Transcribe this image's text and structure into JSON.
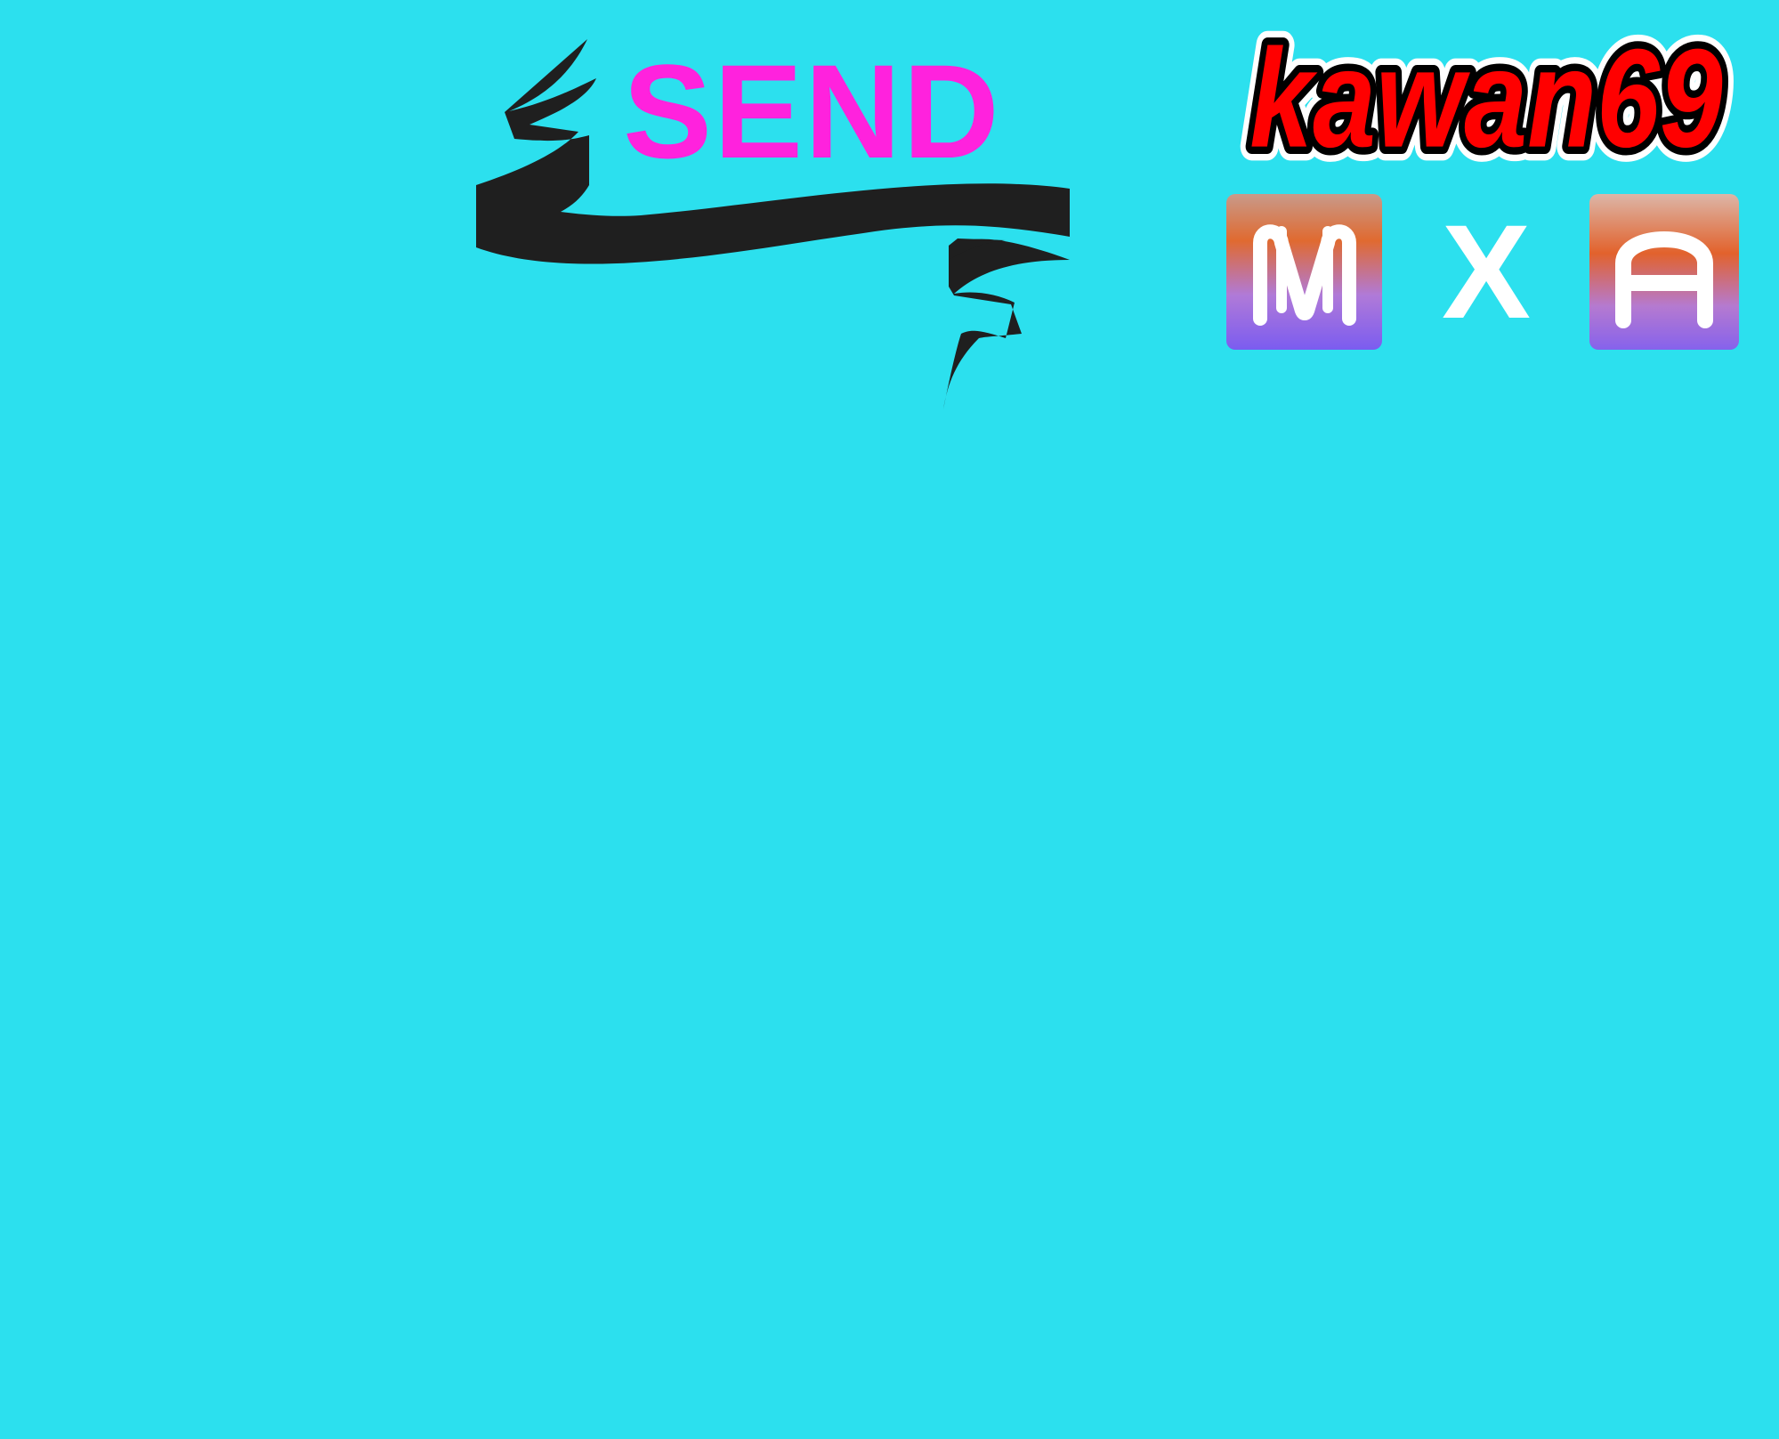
{
  "canvas": {
    "background": "#2ce0ee"
  },
  "banner": {
    "label": "SEND",
    "label_color": "#ff22dd",
    "ribbon_color": "#1f1f1f"
  },
  "brand": {
    "name": "kawan69",
    "fill_color": "#ff0000",
    "outline_color": "#000000",
    "halo_color": "#ffffff"
  },
  "pairing": {
    "left_logo": {
      "letter": "M",
      "icon": "m-logo-icon"
    },
    "separator": "X",
    "right_logo": {
      "letter": "A",
      "icon": "a-logo-icon"
    },
    "glyph_color": "#ffffff"
  }
}
